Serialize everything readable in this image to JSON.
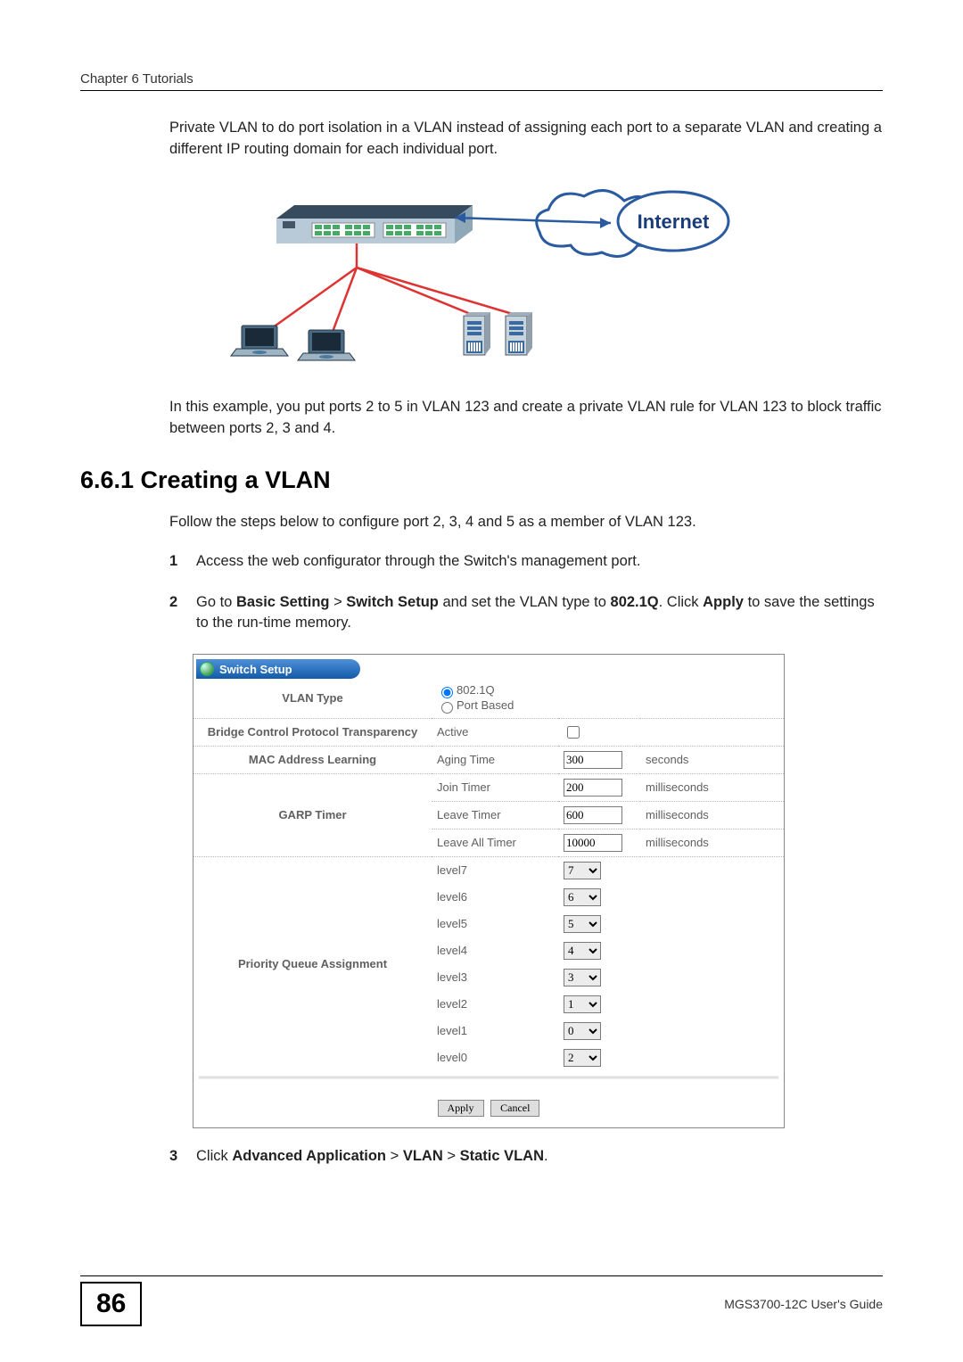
{
  "header": {
    "chapter": "Chapter 6 Tutorials"
  },
  "intro_para": "Private VLAN to do port isolation in a VLAN instead of assigning each port to a separate VLAN and creating a different IP routing domain for each individual port.",
  "diagram": {
    "internet_label": "Internet"
  },
  "example_para": "In this example, you put ports 2 to 5 in VLAN 123 and create a private VLAN rule for VLAN 123 to block traffic between ports 2, 3 and 4.",
  "section_heading": "6.6.1  Creating a VLAN",
  "follow_para": "Follow the steps below to configure port 2, 3, 4 and 5 as a member of VLAN 123.",
  "steps": {
    "s1_num": "1",
    "s1_text": "Access the web configurator through the Switch's management port.",
    "s2_num": "2",
    "s2_pre": "Go to ",
    "s2_b1": "Basic Setting",
    "s2_gt1": " > ",
    "s2_b2": "Switch Setup",
    "s2_mid": " and set the VLAN type to ",
    "s2_b3": "802.1Q",
    "s2_post1": ". Click ",
    "s2_b4": "Apply",
    "s2_post2": " to save the settings to the run-time memory.",
    "s3_num": "3",
    "s3_pre": "Click ",
    "s3_b1": "Advanced Application",
    "s3_gt1": " > ",
    "s3_b2": "VLAN",
    "s3_gt2": " > ",
    "s3_b3": "Static VLAN",
    "s3_post": "."
  },
  "switch_setup": {
    "title": "Switch Setup",
    "rows": {
      "vlan_type_label": "VLAN Type",
      "vlan_type_opt1": "802.1Q",
      "vlan_type_opt2": "Port Based",
      "bridge_label": "Bridge Control Protocol Transparency",
      "bridge_col": "Active",
      "mac_label": "MAC Address Learning",
      "mac_col": "Aging Time",
      "mac_val": "300",
      "mac_unit": "seconds",
      "garp_label": "GARP Timer",
      "join_col": "Join Timer",
      "join_val": "200",
      "join_unit": "milliseconds",
      "leave_col": "Leave Timer",
      "leave_val": "600",
      "leave_unit": "milliseconds",
      "leaveall_col": "Leave All Timer",
      "leaveall_val": "10000",
      "leaveall_unit": "milliseconds",
      "pqa_label": "Priority Queue Assignment",
      "levels": [
        {
          "name": "level7",
          "val": "7"
        },
        {
          "name": "level6",
          "val": "6"
        },
        {
          "name": "level5",
          "val": "5"
        },
        {
          "name": "level4",
          "val": "4"
        },
        {
          "name": "level3",
          "val": "3"
        },
        {
          "name": "level2",
          "val": "1"
        },
        {
          "name": "level1",
          "val": "0"
        },
        {
          "name": "level0",
          "val": "2"
        }
      ]
    },
    "buttons": {
      "apply": "Apply",
      "cancel": "Cancel"
    }
  },
  "footer": {
    "page_num": "86",
    "guide": "MGS3700-12C User's Guide"
  }
}
